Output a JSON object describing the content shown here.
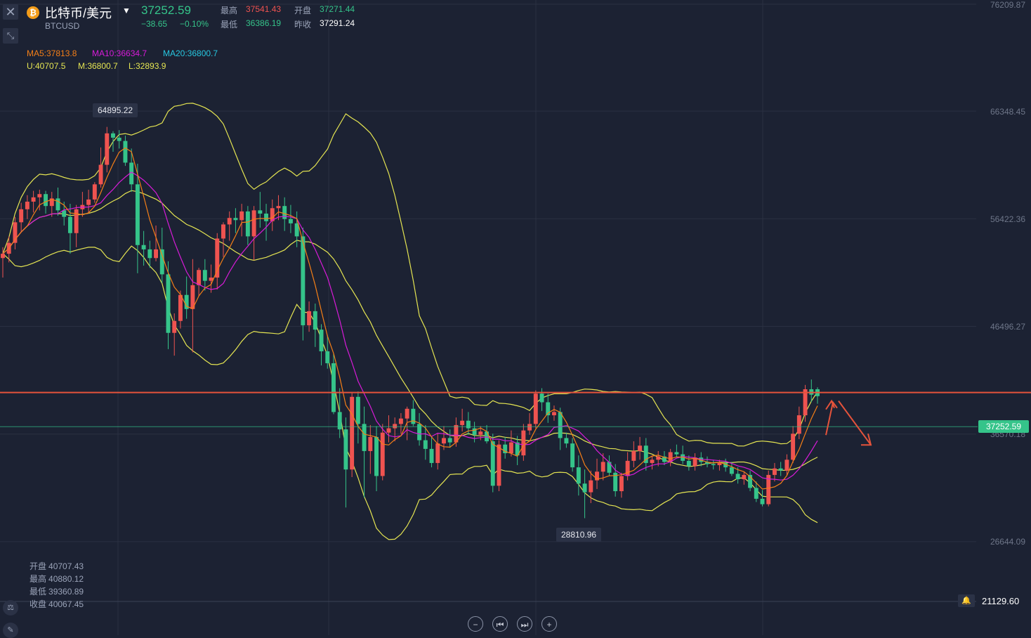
{
  "header": {
    "close_icon": "close-icon",
    "coin_glyph": "₿",
    "symbol_name": "比特币/美元",
    "symbol_code": "BTCUSD",
    "last_price": "37252.59",
    "change": "−38.65",
    "change_pct": "−0.10%",
    "high_label": "最高",
    "high_value": "37541.43",
    "open_label": "开盘",
    "open_value": "37271.44",
    "low_label": "最低",
    "low_value": "36386.19",
    "prev_close_label": "昨收",
    "prev_close_value": "37291.24"
  },
  "indicators": {
    "ma5": "MA5:37813.8",
    "ma10": "MA10:36634.7",
    "ma20": "MA20:36800.7",
    "boll_u": "U:40707.5",
    "boll_m": "M:36800.7",
    "boll_l": "L:32893.9"
  },
  "ohlc_panel": {
    "open_label": "开盘",
    "open_value": "40707.43",
    "high_label": "最高",
    "high_value": "40880.12",
    "low_label": "最低",
    "low_value": "39360.89",
    "close_label": "收盘",
    "close_value": "40067.45"
  },
  "colors": {
    "up": "#ef5350",
    "down": "#35c48a",
    "ma5": "#f57f17",
    "ma10": "#d81bd8",
    "boll": "#e5e552",
    "resistance": "#e5533b",
    "background": "#1c2233",
    "grid": "#2a3042"
  },
  "callouts": {
    "max": "64895.22",
    "min": "28810.96"
  },
  "price_tag": "37252.59",
  "bottom_value": "21129.60",
  "controls": {
    "zoom_out": "−",
    "prev": "⏮",
    "next": "⏭",
    "zoom_in": "+"
  },
  "chart_data": {
    "type": "candlestick",
    "title": "比特币/美元",
    "symbol": "BTCUSD",
    "y_ticks": [
      "76209.87",
      "66348.45",
      "56422.36",
      "46496.27",
      "36570.18",
      "26644.09"
    ],
    "ylim": [
      21129.6,
      76209.87
    ],
    "last_price": 37252.59,
    "resistance_level": 40400,
    "candles": [
      {
        "o": 52800,
        "h": 53800,
        "l": 51000,
        "c": 53200
      },
      {
        "o": 53200,
        "h": 54800,
        "l": 52400,
        "c": 54200
      },
      {
        "o": 54200,
        "h": 56600,
        "l": 53600,
        "c": 56100
      },
      {
        "o": 56100,
        "h": 57900,
        "l": 55200,
        "c": 57300
      },
      {
        "o": 57300,
        "h": 58600,
        "l": 56400,
        "c": 58000
      },
      {
        "o": 58000,
        "h": 59000,
        "l": 57000,
        "c": 58400
      },
      {
        "o": 58400,
        "h": 59100,
        "l": 57200,
        "c": 58700
      },
      {
        "o": 58700,
        "h": 59000,
        "l": 56900,
        "c": 57600
      },
      {
        "o": 57600,
        "h": 58900,
        "l": 56600,
        "c": 58300
      },
      {
        "o": 58300,
        "h": 59300,
        "l": 56700,
        "c": 57200
      },
      {
        "o": 57200,
        "h": 58000,
        "l": 55800,
        "c": 56600
      },
      {
        "o": 56600,
        "h": 57800,
        "l": 53200,
        "c": 55100
      },
      {
        "o": 55100,
        "h": 57700,
        "l": 53800,
        "c": 57300
      },
      {
        "o": 57300,
        "h": 58900,
        "l": 56600,
        "c": 57700
      },
      {
        "o": 57700,
        "h": 59100,
        "l": 56900,
        "c": 58200
      },
      {
        "o": 58200,
        "h": 59800,
        "l": 57900,
        "c": 59600
      },
      {
        "o": 59600,
        "h": 63000,
        "l": 59300,
        "c": 61400
      },
      {
        "o": 61400,
        "h": 64895.22,
        "l": 60700,
        "c": 64300
      },
      {
        "o": 64300,
        "h": 64500,
        "l": 62600,
        "c": 63900
      },
      {
        "o": 63900,
        "h": 64600,
        "l": 62900,
        "c": 63600
      },
      {
        "o": 63600,
        "h": 64100,
        "l": 61300,
        "c": 61600
      },
      {
        "o": 61600,
        "h": 62900,
        "l": 58900,
        "c": 59600
      },
      {
        "o": 59600,
        "h": 61500,
        "l": 51400,
        "c": 54000
      },
      {
        "o": 54000,
        "h": 55300,
        "l": 52100,
        "c": 53600
      },
      {
        "o": 53600,
        "h": 54400,
        "l": 51900,
        "c": 52800
      },
      {
        "o": 52800,
        "h": 55800,
        "l": 52500,
        "c": 53600
      },
      {
        "o": 53600,
        "h": 55600,
        "l": 50500,
        "c": 51300
      },
      {
        "o": 51300,
        "h": 52500,
        "l": 44400,
        "c": 45900
      },
      {
        "o": 45900,
        "h": 47700,
        "l": 43800,
        "c": 47000
      },
      {
        "o": 47000,
        "h": 49800,
        "l": 46300,
        "c": 49400
      },
      {
        "o": 49400,
        "h": 51100,
        "l": 47200,
        "c": 48100
      },
      {
        "o": 48100,
        "h": 52700,
        "l": 44100,
        "c": 50300
      },
      {
        "o": 50300,
        "h": 51900,
        "l": 49300,
        "c": 51700
      },
      {
        "o": 51700,
        "h": 52700,
        "l": 49800,
        "c": 50700
      },
      {
        "o": 50700,
        "h": 52200,
        "l": 49600,
        "c": 51000
      },
      {
        "o": 51000,
        "h": 55100,
        "l": 49900,
        "c": 54600
      },
      {
        "o": 54600,
        "h": 56100,
        "l": 52900,
        "c": 55900
      },
      {
        "o": 55900,
        "h": 57100,
        "l": 54400,
        "c": 56500
      },
      {
        "o": 56500,
        "h": 57400,
        "l": 55100,
        "c": 56300
      },
      {
        "o": 56300,
        "h": 57800,
        "l": 54800,
        "c": 57100
      },
      {
        "o": 57100,
        "h": 57600,
        "l": 54000,
        "c": 54800
      },
      {
        "o": 54800,
        "h": 57600,
        "l": 52600,
        "c": 57200
      },
      {
        "o": 57200,
        "h": 58900,
        "l": 55600,
        "c": 56900
      },
      {
        "o": 56900,
        "h": 57800,
        "l": 54400,
        "c": 56200
      },
      {
        "o": 56200,
        "h": 58200,
        "l": 55300,
        "c": 57400
      },
      {
        "o": 57400,
        "h": 58600,
        "l": 56300,
        "c": 57600
      },
      {
        "o": 57600,
        "h": 58400,
        "l": 55300,
        "c": 56400
      },
      {
        "o": 56400,
        "h": 57700,
        "l": 55100,
        "c": 56000
      },
      {
        "o": 56000,
        "h": 57100,
        "l": 53800,
        "c": 54800
      },
      {
        "o": 54800,
        "h": 55600,
        "l": 45200,
        "c": 46600
      },
      {
        "o": 46600,
        "h": 48800,
        "l": 46000,
        "c": 47900
      },
      {
        "o": 47900,
        "h": 48600,
        "l": 44600,
        "c": 46200
      },
      {
        "o": 46200,
        "h": 46700,
        "l": 42900,
        "c": 44200
      },
      {
        "o": 44200,
        "h": 45700,
        "l": 42600,
        "c": 43100
      },
      {
        "o": 43100,
        "h": 44000,
        "l": 38400,
        "c": 38600
      },
      {
        "o": 38600,
        "h": 40800,
        "l": 36200,
        "c": 37000
      },
      {
        "o": 37000,
        "h": 38100,
        "l": 29800,
        "c": 33300
      },
      {
        "o": 33300,
        "h": 40400,
        "l": 32600,
        "c": 40000
      },
      {
        "o": 40000,
        "h": 40500,
        "l": 35700,
        "c": 37500
      },
      {
        "o": 37500,
        "h": 39100,
        "l": 30700,
        "c": 35000
      },
      {
        "o": 35000,
        "h": 37400,
        "l": 32900,
        "c": 36300
      },
      {
        "o": 36300,
        "h": 37300,
        "l": 31300,
        "c": 32700
      },
      {
        "o": 32700,
        "h": 37500,
        "l": 32300,
        "c": 36700
      },
      {
        "o": 36700,
        "h": 38300,
        "l": 35800,
        "c": 37100
      },
      {
        "o": 37100,
        "h": 38100,
        "l": 35900,
        "c": 37500
      },
      {
        "o": 37500,
        "h": 38500,
        "l": 36600,
        "c": 38000
      },
      {
        "o": 38000,
        "h": 39100,
        "l": 36000,
        "c": 38900
      },
      {
        "o": 38900,
        "h": 39700,
        "l": 37300,
        "c": 37500
      },
      {
        "o": 37500,
        "h": 38500,
        "l": 35500,
        "c": 36000
      },
      {
        "o": 36000,
        "h": 37400,
        "l": 34200,
        "c": 35200
      },
      {
        "o": 35200,
        "h": 36300,
        "l": 33500,
        "c": 33900
      },
      {
        "o": 33900,
        "h": 36600,
        "l": 33300,
        "c": 35700
      },
      {
        "o": 35700,
        "h": 37300,
        "l": 35100,
        "c": 36200
      },
      {
        "o": 36200,
        "h": 37000,
        "l": 35300,
        "c": 35800
      },
      {
        "o": 35800,
        "h": 38100,
        "l": 35400,
        "c": 37400
      },
      {
        "o": 37400,
        "h": 38900,
        "l": 36800,
        "c": 37800
      },
      {
        "o": 37800,
        "h": 38600,
        "l": 36500,
        "c": 37100
      },
      {
        "o": 37100,
        "h": 37700,
        "l": 35800,
        "c": 36500
      },
      {
        "o": 36500,
        "h": 37300,
        "l": 36000,
        "c": 36800
      },
      {
        "o": 36800,
        "h": 37400,
        "l": 35700,
        "c": 35900
      },
      {
        "o": 35900,
        "h": 36600,
        "l": 31200,
        "c": 31800
      },
      {
        "o": 31800,
        "h": 36000,
        "l": 31300,
        "c": 35600
      },
      {
        "o": 35600,
        "h": 36300,
        "l": 34300,
        "c": 34800
      },
      {
        "o": 34800,
        "h": 36900,
        "l": 34500,
        "c": 35800
      },
      {
        "o": 35800,
        "h": 36400,
        "l": 33700,
        "c": 34600
      },
      {
        "o": 34600,
        "h": 37500,
        "l": 34100,
        "c": 36900
      },
      {
        "o": 36900,
        "h": 38500,
        "l": 36500,
        "c": 37500
      },
      {
        "o": 37500,
        "h": 40600,
        "l": 37100,
        "c": 40300
      },
      {
        "o": 40300,
        "h": 40800,
        "l": 38700,
        "c": 39500
      },
      {
        "o": 39500,
        "h": 40300,
        "l": 37600,
        "c": 38300
      },
      {
        "o": 38300,
        "h": 39200,
        "l": 37800,
        "c": 38600
      },
      {
        "o": 38600,
        "h": 39000,
        "l": 35100,
        "c": 36200
      },
      {
        "o": 36200,
        "h": 36700,
        "l": 35300,
        "c": 35700
      },
      {
        "o": 35700,
        "h": 36200,
        "l": 33100,
        "c": 33500
      },
      {
        "o": 33500,
        "h": 34600,
        "l": 30900,
        "c": 32000
      },
      {
        "o": 32000,
        "h": 33300,
        "l": 28810.96,
        "c": 31200
      },
      {
        "o": 31200,
        "h": 33200,
        "l": 30200,
        "c": 32300
      },
      {
        "o": 32300,
        "h": 34300,
        "l": 31500,
        "c": 33100
      },
      {
        "o": 33100,
        "h": 34800,
        "l": 32300,
        "c": 34000
      },
      {
        "o": 34000,
        "h": 34600,
        "l": 32700,
        "c": 33000
      },
      {
        "o": 33000,
        "h": 33800,
        "l": 30800,
        "c": 31300
      },
      {
        "o": 31300,
        "h": 33000,
        "l": 30700,
        "c": 32700
      },
      {
        "o": 32700,
        "h": 34900,
        "l": 32300,
        "c": 34100
      },
      {
        "o": 34100,
        "h": 35900,
        "l": 33500,
        "c": 35000
      },
      {
        "o": 35000,
        "h": 36300,
        "l": 34200,
        "c": 35500
      },
      {
        "o": 35500,
        "h": 36200,
        "l": 33200,
        "c": 33900
      },
      {
        "o": 33900,
        "h": 34600,
        "l": 33300,
        "c": 34200
      },
      {
        "o": 34200,
        "h": 35000,
        "l": 33600,
        "c": 34500
      },
      {
        "o": 34500,
        "h": 35000,
        "l": 33700,
        "c": 34000
      },
      {
        "o": 34000,
        "h": 35200,
        "l": 33600,
        "c": 34900
      },
      {
        "o": 34900,
        "h": 35600,
        "l": 34400,
        "c": 34700
      },
      {
        "o": 34700,
        "h": 35500,
        "l": 33800,
        "c": 34100
      },
      {
        "o": 34100,
        "h": 34600,
        "l": 33200,
        "c": 33600
      },
      {
        "o": 33600,
        "h": 34800,
        "l": 33200,
        "c": 34400
      },
      {
        "o": 34400,
        "h": 34900,
        "l": 33600,
        "c": 34000
      },
      {
        "o": 34000,
        "h": 34500,
        "l": 33500,
        "c": 33800
      },
      {
        "o": 33800,
        "h": 34200,
        "l": 33300,
        "c": 33700
      },
      {
        "o": 33700,
        "h": 34200,
        "l": 33200,
        "c": 33900
      },
      {
        "o": 33900,
        "h": 34300,
        "l": 33100,
        "c": 33500
      },
      {
        "o": 33500,
        "h": 34000,
        "l": 32700,
        "c": 32900
      },
      {
        "o": 32900,
        "h": 33500,
        "l": 32000,
        "c": 32400
      },
      {
        "o": 32400,
        "h": 33100,
        "l": 31900,
        "c": 32800
      },
      {
        "o": 32800,
        "h": 33200,
        "l": 31300,
        "c": 31600
      },
      {
        "o": 31600,
        "h": 32200,
        "l": 30300,
        "c": 30600
      },
      {
        "o": 30600,
        "h": 31400,
        "l": 29900,
        "c": 30100
      },
      {
        "o": 30100,
        "h": 33200,
        "l": 29900,
        "c": 32800
      },
      {
        "o": 32800,
        "h": 33900,
        "l": 32200,
        "c": 33400
      },
      {
        "o": 33400,
        "h": 34000,
        "l": 32700,
        "c": 33200
      },
      {
        "o": 33200,
        "h": 34700,
        "l": 32800,
        "c": 34200
      },
      {
        "o": 34200,
        "h": 37300,
        "l": 33900,
        "c": 36600
      },
      {
        "o": 36600,
        "h": 39100,
        "l": 36100,
        "c": 38300
      },
      {
        "o": 38300,
        "h": 41100,
        "l": 37700,
        "c": 40700
      },
      {
        "o": 40700,
        "h": 41600,
        "l": 39500,
        "c": 40200
      },
      {
        "o": 40700.4,
        "h": 40880.12,
        "l": 39360.89,
        "c": 40067.45
      }
    ],
    "annotations": [
      {
        "type": "label",
        "text": "64895.22",
        "kind": "max"
      },
      {
        "type": "label",
        "text": "28810.96",
        "kind": "min"
      },
      {
        "type": "hline",
        "value": 40400,
        "color": "#e5533b"
      }
    ]
  }
}
